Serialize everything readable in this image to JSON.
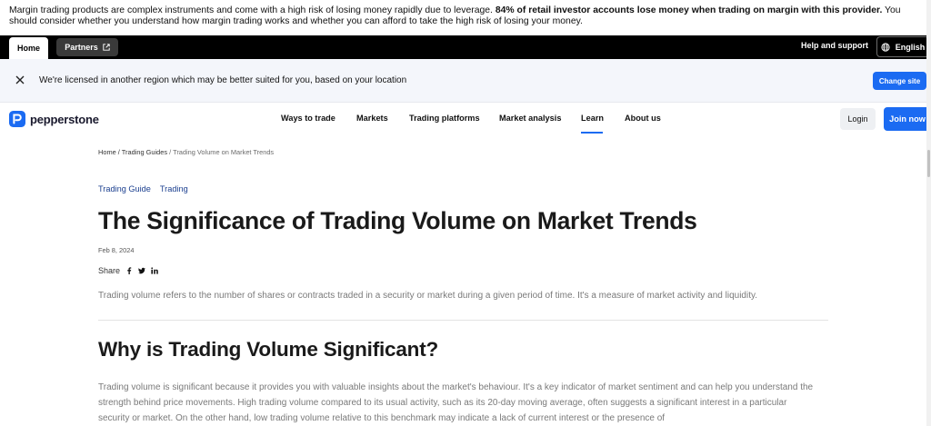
{
  "risk_warning": {
    "text_start": "Margin trading products are complex instruments and come with a high risk of losing money rapidly due to leverage. ",
    "text_bold": "84% of retail investor accounts lose money when trading on margin with this provider.",
    "text_end": " You should consider whether you understand how margin trading works and whether you can afford to take the high risk of losing your money."
  },
  "topbar": {
    "home_tab": "Home",
    "partners_tab": "Partners",
    "help_link": "Help and support",
    "language": "English"
  },
  "notice": {
    "text": "We're licensed in another region which may be better suited for you, based on your location",
    "button": "Change site"
  },
  "nav": {
    "logo": "pepperstone",
    "items": [
      "Ways to trade",
      "Markets",
      "Trading platforms",
      "Market analysis",
      "Learn",
      "About us"
    ],
    "active": "Learn",
    "login": "Login",
    "join": "Join now"
  },
  "breadcrumb": {
    "home": "Home",
    "section": "Trading Guides",
    "current": "Trading Volume on Market Trends"
  },
  "article": {
    "tags": [
      "Trading Guide",
      "Trading"
    ],
    "title": "The Significance of Trading Volume on Market Trends",
    "date": "Feb 8, 2024",
    "share_label": "Share",
    "intro": "Trading volume refers to the number of shares or contracts traded in a security or market during a given period of time. It's a measure of market activity and liquidity.",
    "section_heading": "Why is Trading Volume Significant?",
    "section_body": "Trading volume is significant because it provides you with valuable insights about the market's behaviour. It's a key indicator of market sentiment and can help you understand the strength behind price movements. High trading volume compared to its usual activity, such as its 20-day moving average, often suggests a significant interest in a particular security or market. On the other hand, low trading volume relative to this benchmark may indicate a lack of current interest or the presence of"
  },
  "icons": {
    "notice_close": "close-icon",
    "external": "external-link-icon",
    "language": "globe-icon",
    "logo": "pepperstone-logo-icon",
    "share": [
      "facebook-icon",
      "twitter-icon",
      "linkedin-icon"
    ]
  },
  "colors": {
    "accent": "#1b6bf2",
    "topbar": "#000000",
    "notice_bg": "#f4f6fb",
    "tag": "#1b3f8f"
  }
}
